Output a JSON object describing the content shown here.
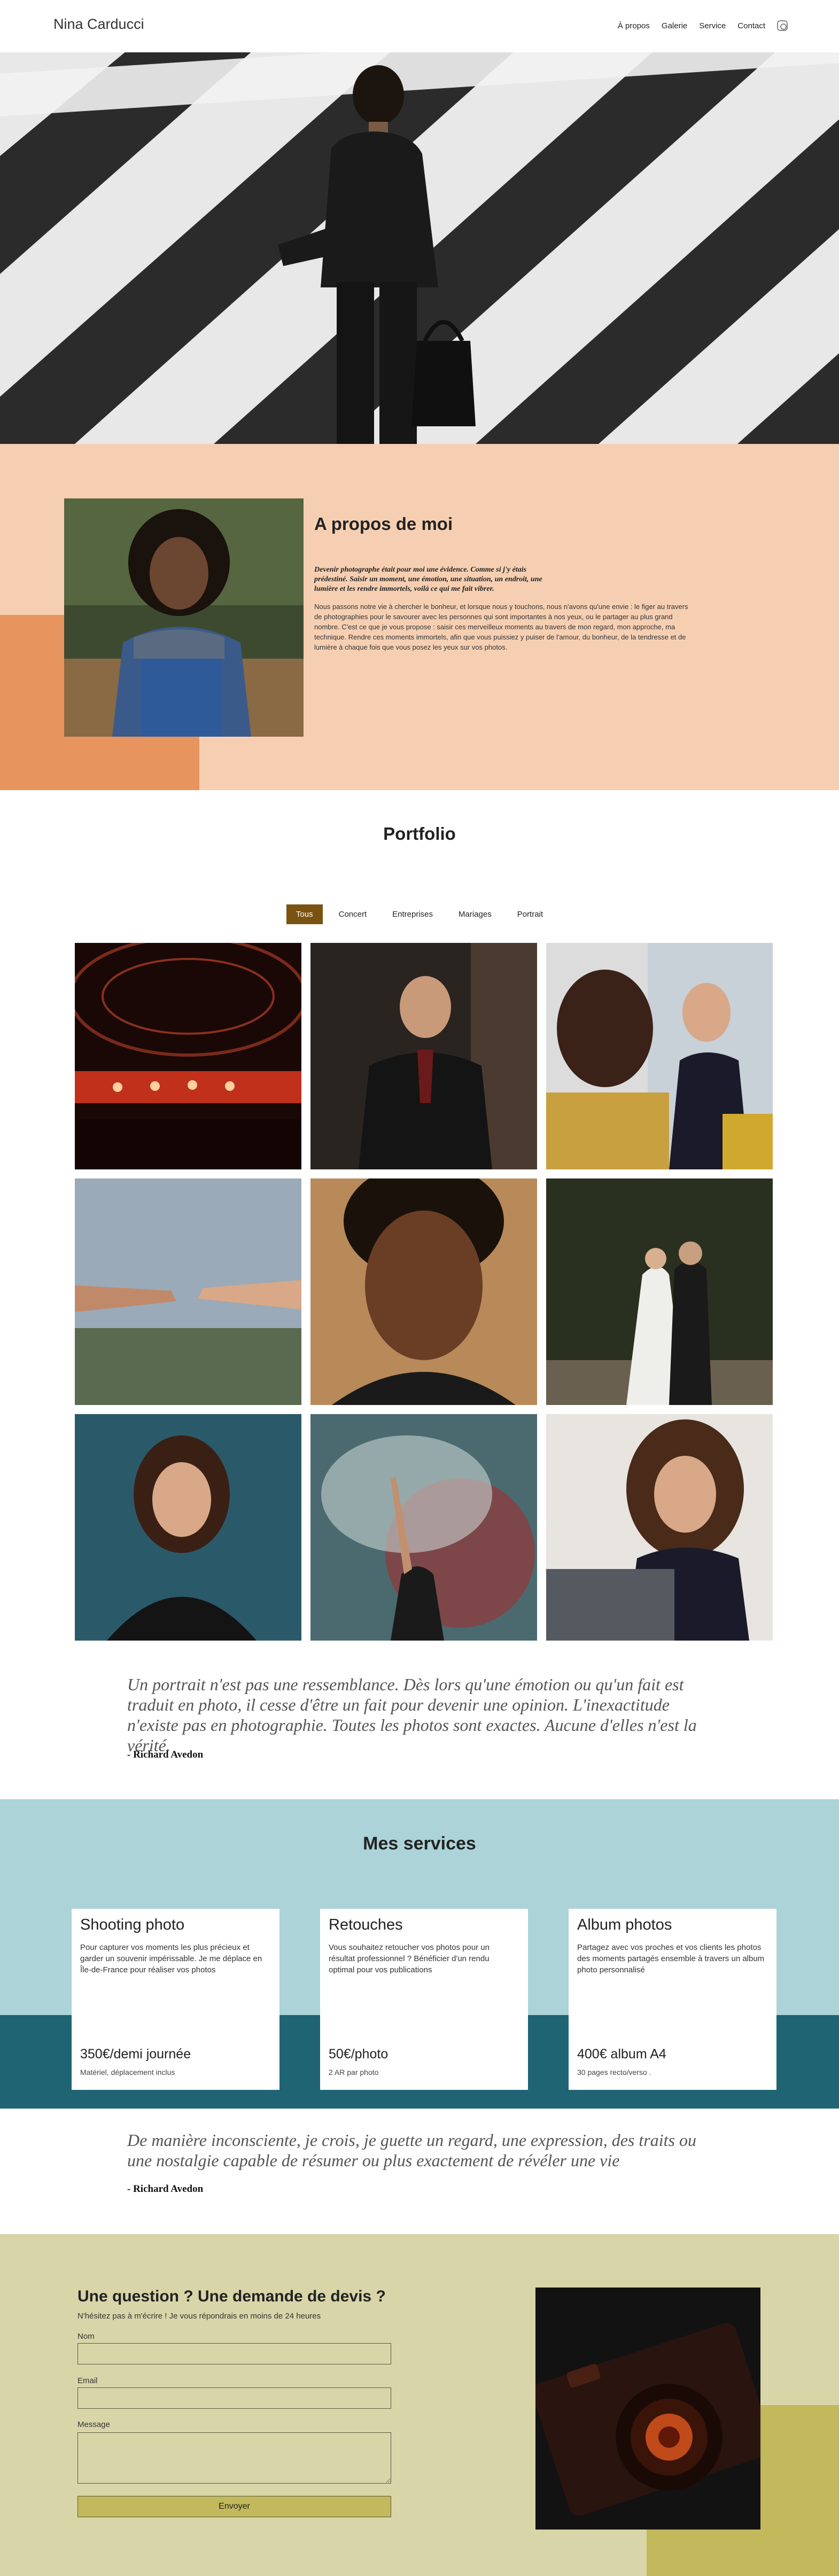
{
  "header": {
    "brand": "Nina Carducci",
    "nav": [
      "À propos",
      "Galerie",
      "Service",
      "Contact"
    ],
    "social_icon": "instagram-icon"
  },
  "hero": {
    "carousel_total": 3,
    "carousel_active_index": 0
  },
  "about": {
    "title": "A propos de moi",
    "lead": "Devenir photographe était pour moi une évidence. Comme si j'y étais prédestiné. Saisir un moment, une émotion, une situation, un endroit, une lumière et les rendre immortels, voilà ce qui me fait vibrer.",
    "body": "Nous passons notre vie à chercher le bonheur, et lorsque nous y touchons, nous n'avons qu'une envie : le figer au travers de photographies pour le savourer avec les personnes qui sont importantes à nos yeux, ou le partager au plus grand nombre. C'est ce que je vous propose : saisir ces merveilleux moments au travers de mon regard, mon approche, ma technique. Rendre ces moments immortels, afin que vous puissiez y puiser de l'amour, du bonheur, de la tendresse et de lumière à chaque fois que vous posez les yeux sur vos photos."
  },
  "portfolio": {
    "title": "Portfolio",
    "filters": [
      "Tous",
      "Concert",
      "Entreprises",
      "Mariages",
      "Portrait"
    ],
    "active_filter": "Tous",
    "photos": [
      "concert-stage-photo",
      "businessman-photo",
      "business-meeting-photo",
      "hands-photo",
      "portrait-man-photo",
      "wedding-couple-photo",
      "portrait-woman-photo",
      "concert-crowd-photo",
      "woman-laptop-photo"
    ]
  },
  "quote1": {
    "text": "Un portrait n'est pas une ressemblance. Dès lors qu'une émotion ou qu'un fait est traduit en photo, il cesse d'être un fait pour devenir une opinion. L'inexactitude n'existe pas en photographie. Toutes les photos sont exactes. Aucune d'elles n'est la vérité.",
    "author": "- Richard Avedon"
  },
  "services": {
    "title": "Mes services",
    "cards": [
      {
        "title": "Shooting photo",
        "desc": "Pour capturer vos moments les plus précieux et garder un souvenir impérissable. Je me déplace en Île-de-France pour réaliser vos photos",
        "price": "350€/demi journée",
        "note": "Matériel, déplacement inclus"
      },
      {
        "title": "Retouches",
        "desc": "Vous souhaitez retoucher vos photos pour un résultat professionnel ? Bénéficier d'un rendu optimal pour vos publications",
        "price": "50€/photo",
        "note": "2 AR par photo"
      },
      {
        "title": "Album photos",
        "desc": "Partagez avec vos proches et vos clients les photos des moments partagés ensemble à travers un album photo personnalisé",
        "price": "400€ album A4",
        "note": "30 pages recto/verso ."
      }
    ]
  },
  "quote2": {
    "text": "De manière inconsciente, je crois, je guette un regard, une expression, des traits ou une nostalgie capable de résumer ou plus exactement de révéler une vie",
    "author": "- Richard Avedon"
  },
  "contact": {
    "title": "Une question ? Une demande de devis ?",
    "subtitle": "N'hésitez pas à m'écrire ! Je vous répondrais en moins de 24 heures",
    "name_label": "Nom",
    "email_label": "Email",
    "message_label": "Message",
    "submit": "Envoyer"
  },
  "colors": {
    "about_bg": "#f6cfb2",
    "about_accent": "#e8945e",
    "filter_active": "#7a5310",
    "services_bg": "#abd3d8",
    "services_dark": "#1f6473",
    "contact_bg": "#d8d5a8",
    "contact_accent": "#c2b85c"
  }
}
